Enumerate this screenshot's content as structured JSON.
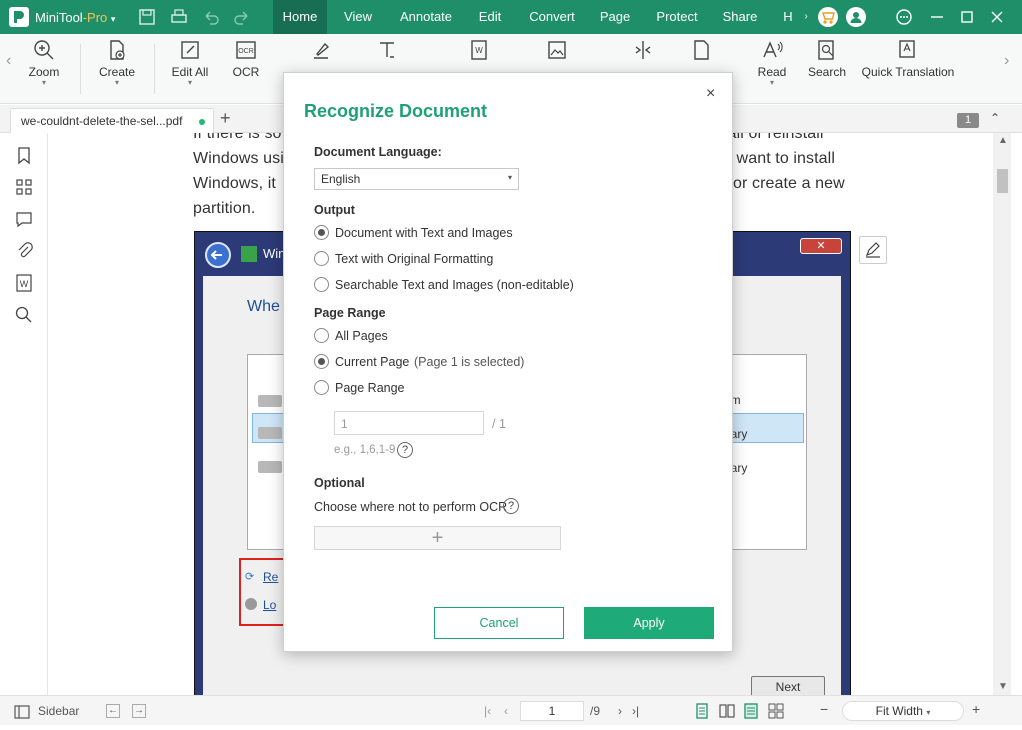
{
  "titlebar": {
    "app_name": "MiniTool",
    "app_suffix": "-Pro",
    "menus": [
      "Home",
      "View",
      "Annotate",
      "Edit",
      "Convert",
      "Page",
      "Protect",
      "Share",
      "H"
    ],
    "active_menu": "Home"
  },
  "ribbon": {
    "items": [
      "Zoom",
      "Create",
      "Edit All",
      "OCR",
      "Read",
      "Search",
      "Quick Translation"
    ]
  },
  "tabs": {
    "doc_title": "we-couldnt-delete-the-sel...pdf",
    "add": "+",
    "page_badge": "1"
  },
  "document": {
    "line1": "If there is so",
    "line1_right": "nstall or reinstall",
    "line2": "Windows usi",
    "line2_right": "ou want to install",
    "line3": "Windows, it",
    "line3_right": "or create a new",
    "line4": "partition.",
    "shot": {
      "title": "Win",
      "heading": "Whe",
      "list_right": [
        "e",
        "em",
        "nary",
        "nary"
      ],
      "link1": "Re",
      "link2": "Lo",
      "next": "Next"
    }
  },
  "dialog": {
    "title": "Recognize Document",
    "close": "×",
    "language_label": "Document Language:",
    "language_value": "English",
    "output_label": "Output",
    "output_options": [
      "Document with Text and Images",
      "Text with Original Formatting",
      "Searchable Text and Images (non-editable)"
    ],
    "output_selected": 0,
    "page_range_label": "Page Range",
    "page_options": [
      "All Pages",
      "Current Page",
      "Page Range"
    ],
    "current_page_note": "(Page 1 is selected)",
    "page_selected": 1,
    "range_value": "1",
    "range_total": "/ 1",
    "range_hint": "e.g., 1,6,1-9",
    "optional_label": "Optional",
    "ocr_hint": "Choose where not to perform OCR",
    "ocr_add": "+",
    "cancel": "Cancel",
    "apply": "Apply"
  },
  "statusbar": {
    "sidebar": "Sidebar",
    "page_current": "1",
    "page_total": "/9",
    "zoom_mode": "Fit Width"
  },
  "colors": {
    "brand": "#1f8f6a",
    "accent": "#1faa7a"
  }
}
